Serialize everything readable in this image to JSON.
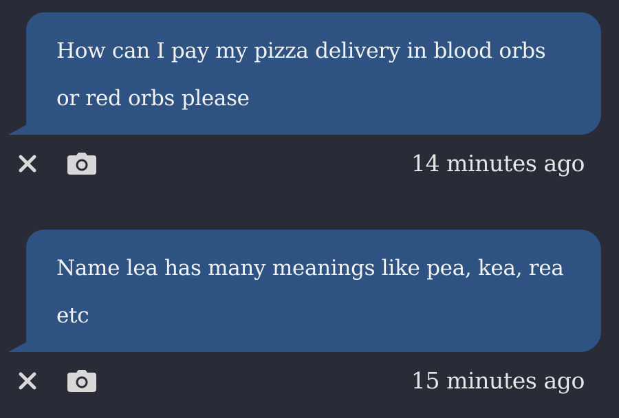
{
  "messages": [
    {
      "text": "How can I pay my pizza delivery in blood orbs or red orbs please",
      "timestamp": "14 minutes ago"
    },
    {
      "text": "Name lea has many meanings like pea, kea, rea etc",
      "timestamp": "15 minutes ago"
    }
  ],
  "icons": {
    "close": "close-icon",
    "camera": "camera-icon"
  },
  "colors": {
    "background": "#292c36",
    "bubble": "#2e5383",
    "text": "#f2f2f2",
    "icon": "#d8d8d8"
  }
}
